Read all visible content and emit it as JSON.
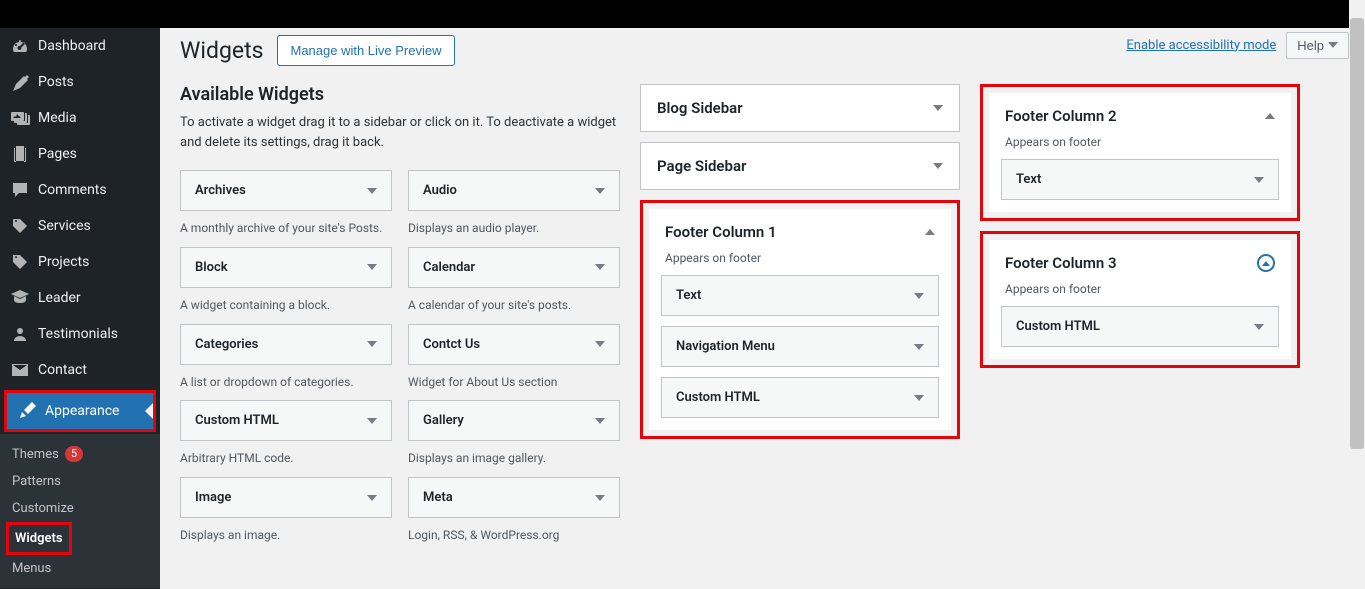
{
  "actions": {
    "accessibility": "Enable accessibility mode",
    "help": "Help"
  },
  "page": {
    "title": "Widgets",
    "live_btn": "Manage with Live Preview",
    "section_title": "Available Widgets",
    "section_desc": "To activate a widget drag it to a sidebar or click on it. To deactivate a widget and delete its settings, drag it back."
  },
  "sidebar_menu": {
    "items": [
      {
        "label": "Dashboard"
      },
      {
        "label": "Posts"
      },
      {
        "label": "Media"
      },
      {
        "label": "Pages"
      },
      {
        "label": "Comments"
      },
      {
        "label": "Services"
      },
      {
        "label": "Projects"
      },
      {
        "label": "Leader"
      },
      {
        "label": "Testimonials"
      },
      {
        "label": "Contact"
      },
      {
        "label": "Appearance"
      }
    ],
    "sub": {
      "themes": "Themes",
      "themes_badge": "5",
      "patterns": "Patterns",
      "customize": "Customize",
      "widgets": "Widgets",
      "menus": "Menus"
    }
  },
  "available": [
    [
      {
        "title": "Archives",
        "desc": "A monthly archive of your site's Posts."
      },
      {
        "title": "Audio",
        "desc": "Displays an audio player."
      }
    ],
    [
      {
        "title": "Block",
        "desc": "A widget containing a block."
      },
      {
        "title": "Calendar",
        "desc": "A calendar of your site's posts."
      }
    ],
    [
      {
        "title": "Categories",
        "desc": "A list or dropdown of categories."
      },
      {
        "title": "Contct Us",
        "desc": "Widget for About Us section"
      }
    ],
    [
      {
        "title": "Custom HTML",
        "desc": "Arbitrary HTML code."
      },
      {
        "title": "Gallery",
        "desc": "Displays an image gallery."
      }
    ],
    [
      {
        "title": "Image",
        "desc": "Displays an image."
      },
      {
        "title": "Meta",
        "desc": "Login, RSS, & WordPress.org"
      }
    ]
  ],
  "areas": {
    "blog": {
      "title": "Blog Sidebar"
    },
    "page": {
      "title": "Page Sidebar"
    },
    "f1": {
      "title": "Footer Column 1",
      "desc": "Appears on footer",
      "widgets": [
        {
          "label": "Text"
        },
        {
          "label": "Navigation Menu"
        },
        {
          "label": "Custom HTML"
        }
      ]
    },
    "f2": {
      "title": "Footer Column 2",
      "desc": "Appears on footer",
      "widgets": [
        {
          "label": "Text"
        }
      ]
    },
    "f3": {
      "title": "Footer Column 3",
      "desc": "Appears on footer",
      "widgets": [
        {
          "label": "Custom HTML"
        }
      ]
    }
  }
}
